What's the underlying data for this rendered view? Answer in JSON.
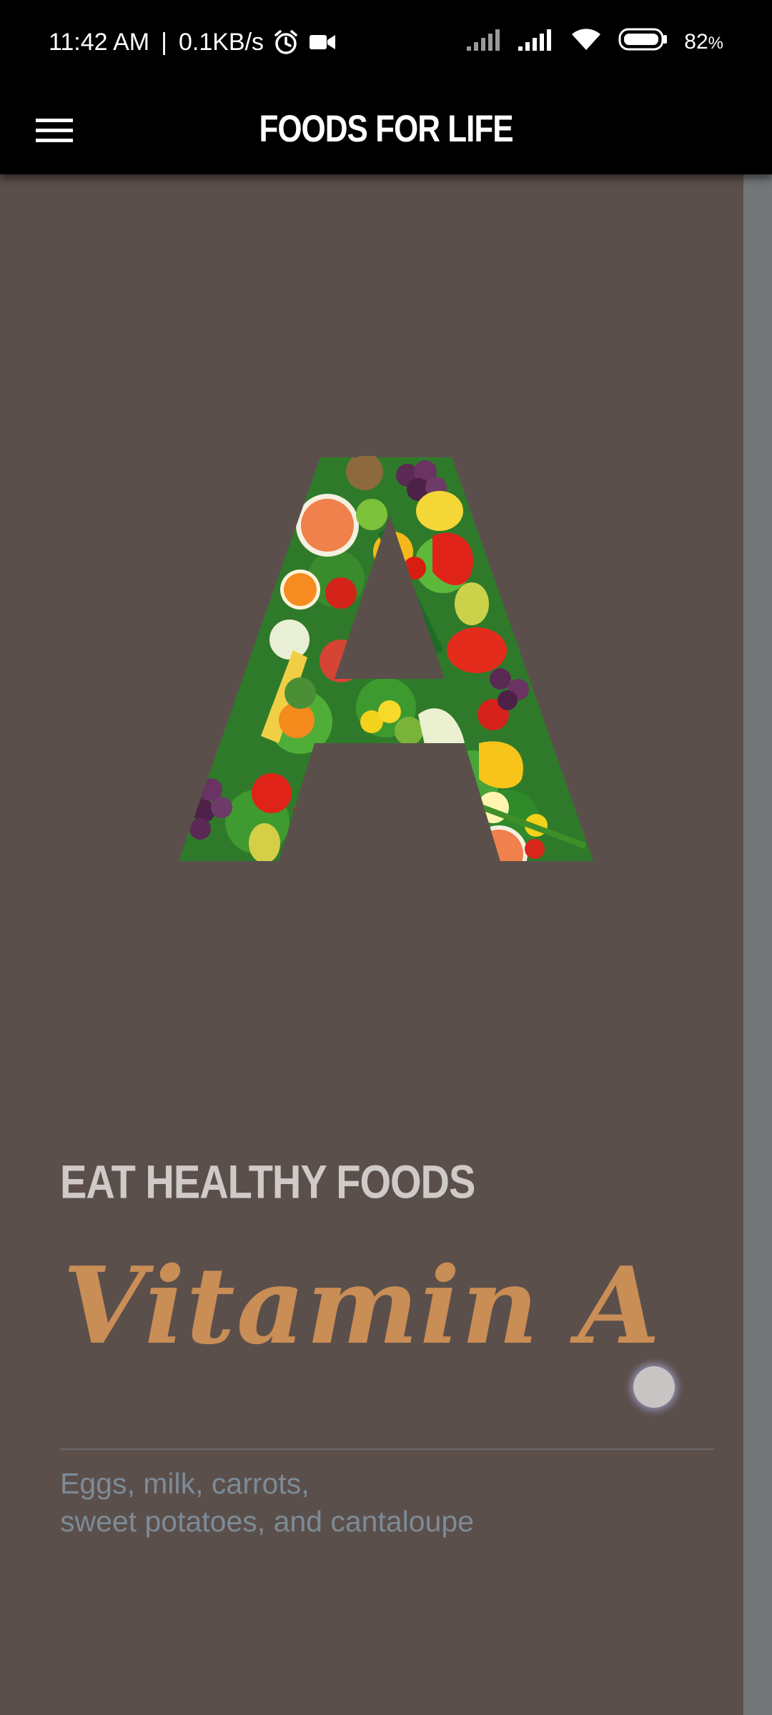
{
  "status_bar": {
    "time": "11:42 AM",
    "separator": "|",
    "network_speed": "0.1KB/s",
    "battery": "82",
    "battery_unit": "%",
    "icons": [
      "alarm-icon",
      "video-camera-icon",
      "signal-icon",
      "signal-icon",
      "wifi-icon",
      "battery-icon"
    ]
  },
  "app_bar": {
    "title": "FOODS FOR LIFE",
    "menu_icon": "hamburger-menu-icon"
  },
  "card": {
    "overline": "EAT HEALTHY FOODS",
    "headline": "Vitamin A",
    "description_line1": "Eggs, milk, carrots,",
    "description_line2": "sweet potatoes, and cantaloupe"
  },
  "colors": {
    "background": "#5b4f4b",
    "side_strip": "#737577",
    "headline": "#c98d56",
    "overline": "#cfcac8",
    "description": "#7c8b97",
    "app_bar": "#000000"
  }
}
